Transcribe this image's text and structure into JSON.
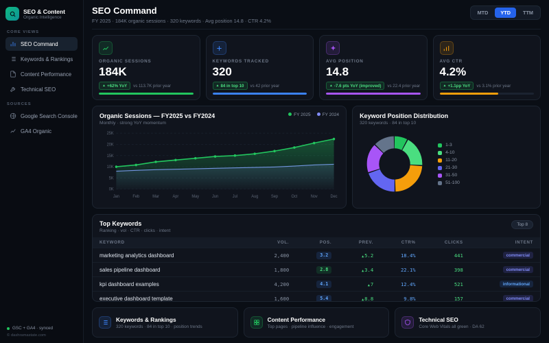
{
  "app": {
    "title": "SEO & Content",
    "subtitle": "Organic Intelligence"
  },
  "sidebar": {
    "core_views_label": "CORE VIEWS",
    "sources_label": "SOURCES",
    "items": [
      {
        "label": "SEO Command",
        "active": true
      },
      {
        "label": "Keywords & Rankings",
        "active": false
      },
      {
        "label": "Content Performance",
        "active": false
      },
      {
        "label": "Technical SEO",
        "active": false
      }
    ],
    "sources": [
      {
        "label": "Google Search Console"
      },
      {
        "label": "GA4 Organic"
      }
    ],
    "sync_status": "GSC + GA4 · synced",
    "copyright": "© dashramastate.com"
  },
  "header": {
    "title": "SEO Command",
    "subtitle": "FY 2025 · 184K organic sessions · 320 keywords · Avg position 14.8 · CTR 4.2%",
    "ranges": [
      {
        "label": "MTD",
        "active": false
      },
      {
        "label": "YTD",
        "active": true
      },
      {
        "label": "TTM",
        "active": false
      }
    ]
  },
  "kpis": [
    {
      "label": "ORGANIC SESSIONS",
      "value": "184K",
      "badge": "+62% YoY",
      "compare": "vs 113.7K prior year",
      "color": "#22c55e",
      "bar_pct": 100
    },
    {
      "label": "KEYWORDS TRACKED",
      "value": "320",
      "badge": "84 in top 10",
      "compare": "vs 42 prior year",
      "color": "#3b82f6",
      "bar_pct": 100
    },
    {
      "label": "AVG POSITION",
      "value": "14.8",
      "badge": "-7.6 pts YoY (improved)",
      "compare": "vs 22.4 prior year",
      "color": "#a855f7",
      "bar_pct": 100
    },
    {
      "label": "AVG CTR",
      "value": "4.2%",
      "badge": "+1.1pp YoY",
      "compare": "vs 3.1% prior year",
      "color": "#f59e0b",
      "bar_pct": 62
    }
  ],
  "chart_data": [
    {
      "type": "area",
      "title": "Organic Sessions — FY2025 vs FY2024",
      "subtitle": "Monthly · strong YoY momentum",
      "x": [
        "Jan",
        "Feb",
        "Mar",
        "Apr",
        "May",
        "Jun",
        "Jul",
        "Aug",
        "Sep",
        "Oct",
        "Nov",
        "Dec"
      ],
      "series": [
        {
          "name": "FY 2025",
          "color": "#22c55e",
          "values": [
            10.0,
            10.8,
            12.2,
            13.0,
            13.8,
            14.6,
            15.0,
            15.8,
            17.0,
            18.6,
            20.6,
            22.4
          ]
        },
        {
          "name": "FY 2024",
          "color": "#818cf8",
          "values": [
            8.0,
            8.4,
            8.7,
            8.9,
            9.1,
            9.3,
            9.5,
            9.7,
            9.9,
            10.3,
            10.8,
            11.1
          ]
        }
      ],
      "unit": "K sessions",
      "ylim": [
        0,
        25
      ],
      "yticks": [
        "0K",
        "5K",
        "10K",
        "15K",
        "20K",
        "25K"
      ],
      "grid": true,
      "legend_position": "top-right"
    },
    {
      "type": "pie",
      "donut": true,
      "title": "Keyword Position Distribution",
      "subtitle": "320 keywords · 84 in top 10",
      "labels": [
        "1-3",
        "4-10",
        "11-20",
        "21-30",
        "31-50",
        "51-100"
      ],
      "values": [
        26,
        58,
        76,
        64,
        56,
        40
      ],
      "colors": [
        "#22c55e",
        "#4ade80",
        "#f59e0b",
        "#6366f1",
        "#a855f7",
        "#64748b"
      ],
      "legend_position": "right"
    }
  ],
  "table": {
    "title": "Top Keywords",
    "subtitle": "Ranking · vol · CTR · clicks · intent",
    "badge": "Top 8",
    "columns": [
      "KEYWORD",
      "VOL.",
      "POS.",
      "PREV.",
      "CTR%",
      "CLICKS",
      "INTENT"
    ],
    "rows": [
      {
        "keyword": "marketing analytics dashboard",
        "vol": "2,400",
        "pos": "3.2",
        "pos_tone": "blue",
        "prev": "5.2",
        "ctr": "18.4%",
        "clicks": "441",
        "intent": "commercial",
        "intent_tone": "indigo"
      },
      {
        "keyword": "sales pipeline dashboard",
        "vol": "1,800",
        "pos": "2.8",
        "pos_tone": "green",
        "prev": "3.4",
        "ctr": "22.1%",
        "clicks": "398",
        "intent": "commercial",
        "intent_tone": "indigo"
      },
      {
        "keyword": "kpi dashboard examples",
        "vol": "4,200",
        "pos": "4.1",
        "pos_tone": "blue",
        "prev": "7",
        "ctr": "12.4%",
        "clicks": "521",
        "intent": "informational",
        "intent_tone": "blue"
      },
      {
        "keyword": "executive dashboard template",
        "vol": "1,600",
        "pos": "5.4",
        "pos_tone": "blue",
        "prev": "8.8",
        "ctr": "9.8%",
        "clicks": "157",
        "intent": "commercial",
        "intent_tone": "indigo"
      }
    ]
  },
  "footer_cards": [
    {
      "title": "Keywords & Rankings",
      "subtitle": "320 keywords · 84 in top 10 · position trends",
      "color": "#3b82f6"
    },
    {
      "title": "Content Performance",
      "subtitle": "Top pages · pipeline influence · engagement",
      "color": "#22c55e"
    },
    {
      "title": "Technical SEO",
      "subtitle": "Core Web Vitals all green · DA 62",
      "color": "#a855f7"
    }
  ],
  "colors": {
    "accent_green": "#22c55e",
    "accent_blue": "#3b82f6",
    "accent_purple": "#a855f7",
    "accent_orange": "#f59e0b"
  }
}
